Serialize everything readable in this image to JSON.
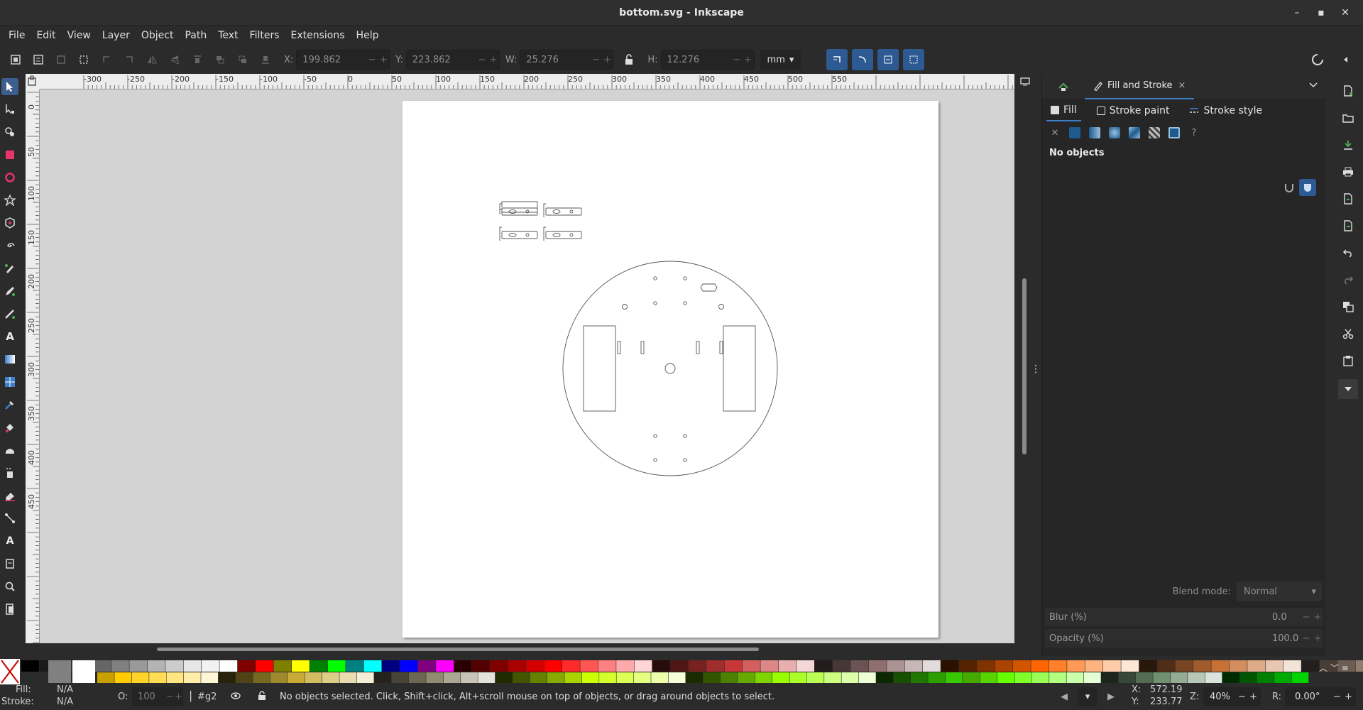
{
  "window": {
    "title": "bottom.svg - Inkscape",
    "controls": [
      "–",
      "▪",
      "✕"
    ]
  },
  "menu": [
    "File",
    "Edit",
    "View",
    "Layer",
    "Object",
    "Path",
    "Text",
    "Filters",
    "Extensions",
    "Help"
  ],
  "toolbar": {
    "x_label": "X:",
    "x_value": "199.862",
    "y_label": "Y:",
    "y_value": "223.862",
    "w_label": "W:",
    "w_value": "25.276",
    "h_label": "H:",
    "h_value": "12.276",
    "unit": "mm",
    "minus": "−",
    "plus": "+"
  },
  "rulers": {
    "h_ticks": [
      "-300",
      "-250",
      "-200",
      "-150",
      "-100",
      "-50",
      "0",
      "50",
      "100",
      "150",
      "200",
      "250",
      "300",
      "350",
      "400",
      "450",
      "500",
      "550"
    ],
    "v_ticks": [
      "0",
      "50",
      "100",
      "150",
      "200",
      "250",
      "300",
      "350",
      "400",
      "450"
    ]
  },
  "dock": {
    "tab_label": "Fill and Stroke",
    "tab_close": "×",
    "subtabs": [
      "Fill",
      "Stroke paint",
      "Stroke style"
    ],
    "paint_unknown": "?",
    "paint_none": "✕",
    "status": "No objects",
    "blend_label": "Blend mode:",
    "blend_value": "Normal",
    "blur_label": "Blur (%)",
    "blur_value": "0.0",
    "opacity_label": "Opacity (%)",
    "opacity_value": "100.0"
  },
  "status": {
    "fill_label": "Fill:",
    "fill_value": "N/A",
    "stroke_label": "Stroke:",
    "stroke_value": "N/A",
    "o_label": "O:",
    "o_value": "100",
    "layer": "#g2",
    "message": "No objects selected. Click, Shift+click, Alt+scroll mouse on top of objects, or drag around objects to select.",
    "x_label": "X:",
    "x_value": "572.19",
    "y_label": "Y:",
    "y_value": "233.77",
    "z_label": "Z:",
    "zoom": "40%",
    "r_label": "R:",
    "rotation": "0.00°"
  },
  "colors": {
    "accent": "#3d7fc9",
    "snap_active": "#2d5a93"
  }
}
